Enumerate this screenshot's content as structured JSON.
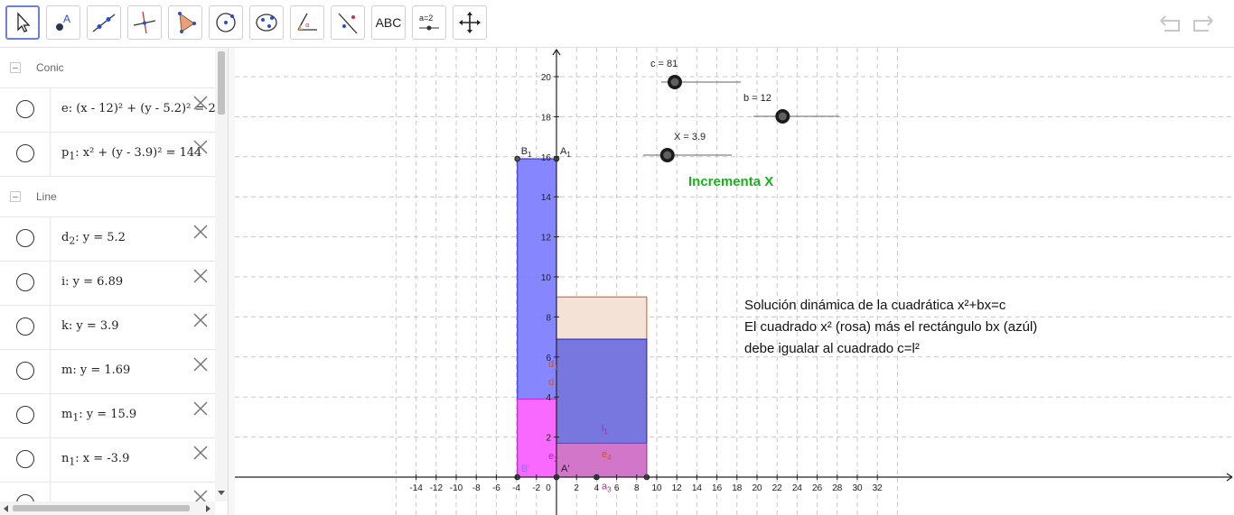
{
  "toolbar": {
    "tools": [
      {
        "name": "move-tool"
      },
      {
        "name": "point-tool"
      },
      {
        "name": "line-tool"
      },
      {
        "name": "perpendicular-line-tool"
      },
      {
        "name": "polygon-tool"
      },
      {
        "name": "circle-tool"
      },
      {
        "name": "ellipse-tool"
      },
      {
        "name": "angle-tool"
      },
      {
        "name": "reflect-tool"
      },
      {
        "name": "text-tool",
        "label": "ABC"
      },
      {
        "name": "slider-tool",
        "label": "a=2"
      },
      {
        "name": "move-graphics-tool"
      }
    ],
    "undo_icon": "undo-icon",
    "redo_icon": "redo-icon"
  },
  "algebra": {
    "groups": [
      {
        "label": "Conic",
        "items": [
          {
            "name": "e",
            "sub": "",
            "expr": ": (x - 12)² + (y - 5.2)² = 2"
          },
          {
            "name": "p",
            "sub": "1",
            "expr": ": x² + (y - 3.9)² = 144"
          }
        ]
      },
      {
        "label": "Line",
        "items": [
          {
            "name": "d",
            "sub": "2",
            "expr": ": y = 5.2"
          },
          {
            "name": "i",
            "sub": "",
            "expr": ": y = 6.89"
          },
          {
            "name": "k",
            "sub": "",
            "expr": ": y = 3.9"
          },
          {
            "name": "m",
            "sub": "",
            "expr": ": y = 1.69"
          },
          {
            "name": "m",
            "sub": "1",
            "expr": ": y = 15.9"
          },
          {
            "name": "n",
            "sub": "1",
            "expr": ": x = -3.9"
          },
          {
            "name": "...",
            "sub": "",
            "expr": ""
          }
        ]
      }
    ]
  },
  "colors": {
    "blue_fill": "#8080ff",
    "pink_fill": "#ff66ff",
    "peach_fill": "#f4e2d6",
    "slider_dot": "#1a1a1a",
    "incrementa": "#19b219"
  },
  "graphics": {
    "x_ticks": [
      "-14",
      "-12",
      "-10",
      "-8",
      "-6",
      "-4",
      "-2",
      "0",
      "2",
      "4",
      "6",
      "8",
      "10",
      "12",
      "14",
      "16",
      "18",
      "20",
      "22",
      "24",
      "26",
      "28",
      "30",
      "32"
    ],
    "y_ticks": [
      "2",
      "4",
      "6",
      "8",
      "10",
      "12",
      "14",
      "16",
      "18",
      "20"
    ],
    "sliders": [
      {
        "label": "c = 81",
        "value": 81
      },
      {
        "label": "b = 12",
        "value": 12
      },
      {
        "label": "X = 3.9",
        "value": 3.9
      }
    ],
    "button_label": "Incrementa X",
    "text_lines": [
      "Solución dinámica de la cuadrática x²+bx=c",
      "El cuadrado x² (rosa) más el rectángulo bx (azúl)",
      "debe igualar al cuadrado c=l²"
    ],
    "point_labels": [
      {
        "t": "B",
        "s": "1"
      },
      {
        "t": "A",
        "s": "1"
      },
      {
        "t": "A'",
        "s": ""
      },
      {
        "t": "B'",
        "s": ""
      }
    ],
    "segment_labels": [
      {
        "t": "d",
        "s": "1"
      },
      {
        "t": "d",
        "s": ""
      },
      {
        "t": "e",
        "s": "2"
      },
      {
        "t": "i",
        "s": "1"
      },
      {
        "t": "e",
        "s": "4"
      },
      {
        "t": "a",
        "s": "3"
      }
    ]
  }
}
